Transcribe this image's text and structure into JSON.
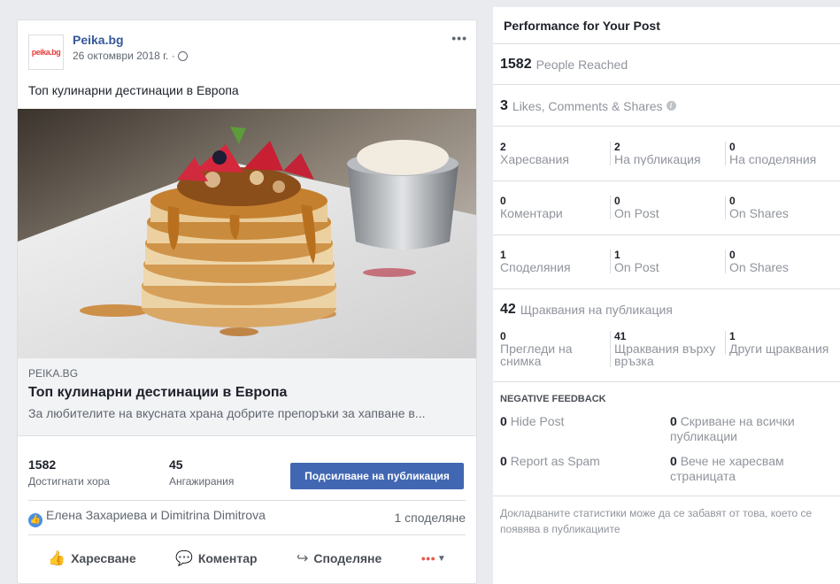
{
  "post": {
    "page_name": "Peika.bg",
    "logo_text": "peika.bg",
    "date": "26 октомври 2018 г. ·",
    "more": "•••",
    "text": "Топ кулинарни дестинации в Европа",
    "link": {
      "domain": "PEIKA.BG",
      "title": "Топ кулинарни дестинации в Европа",
      "description": "За любителите на вкусната храна добрите препоръки за хапване в..."
    },
    "stats": {
      "reached_value": "1582",
      "reached_label": "Достигнати хора",
      "engagements_value": "45",
      "engagements_label": "Ангажирания",
      "boost_label": "Подсилване на публикация"
    },
    "social": {
      "likers": "Елена Захариева и Dimitrina Dimitrova",
      "shares": "1 споделяне"
    },
    "actions": {
      "like": "Харесване",
      "comment": "Коментар",
      "share": "Споделяне"
    }
  },
  "performance": {
    "title": "Performance for Your Post",
    "reached": {
      "value": "1582",
      "label": "People Reached"
    },
    "engagement": {
      "value": "3",
      "label": "Likes, Comments & Shares"
    },
    "reactions": [
      {
        "value": "2",
        "label": "Харесвания"
      },
      {
        "value": "2",
        "label": "На публикация"
      },
      {
        "value": "0",
        "label": "На споделяния"
      }
    ],
    "comments": [
      {
        "value": "0",
        "label": "Коментари"
      },
      {
        "value": "0",
        "label": "On Post"
      },
      {
        "value": "0",
        "label": "On Shares"
      }
    ],
    "shares": [
      {
        "value": "1",
        "label": "Споделяния"
      },
      {
        "value": "1",
        "label": "On Post"
      },
      {
        "value": "0",
        "label": "On Shares"
      }
    ],
    "clicks": {
      "value": "42",
      "label": "Щраквания на публикация"
    },
    "click_breakdown": [
      {
        "value": "0",
        "label": "Прегледи на снимка"
      },
      {
        "value": "41",
        "label": "Щраквания върху връзка"
      },
      {
        "value": "1",
        "label": "Други щраквания"
      }
    ],
    "negative": {
      "title": "NEGATIVE FEEDBACK",
      "items": [
        {
          "value": "0",
          "label": "Hide Post"
        },
        {
          "value": "0",
          "label": "Скриване на всички публикации"
        },
        {
          "value": "0",
          "label": "Report as Spam"
        },
        {
          "value": "0",
          "label": "Вече не харесвам страницата"
        }
      ]
    },
    "footnote": "Докладваните статистики може да се забавят от това, което се появява в публикациите"
  },
  "colors": {
    "accent": "#4267b2",
    "link": "#365899",
    "muted": "#90949c"
  }
}
